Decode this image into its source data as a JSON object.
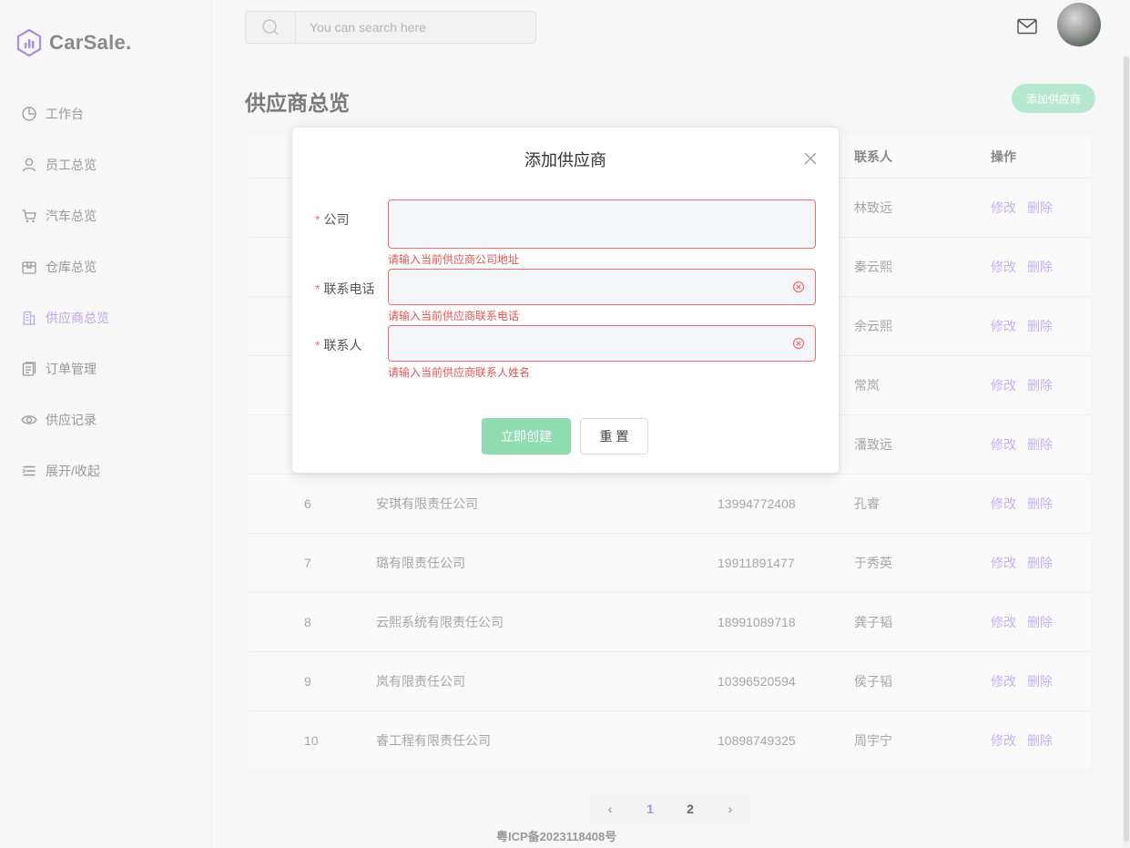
{
  "brand": {
    "name": "CarSale."
  },
  "sidebar": {
    "items": [
      {
        "label": "工作台",
        "icon": "pie-chart-icon",
        "active": false
      },
      {
        "label": "员工总览",
        "icon": "user-icon",
        "active": false
      },
      {
        "label": "汽车总览",
        "icon": "cart-icon",
        "active": false
      },
      {
        "label": "仓库总览",
        "icon": "box-icon",
        "active": false
      },
      {
        "label": "供应商总览",
        "icon": "building-icon",
        "active": true
      },
      {
        "label": "订单管理",
        "icon": "document-icon",
        "active": false
      },
      {
        "label": "供应记录",
        "icon": "eye-icon",
        "active": false
      },
      {
        "label": "展开/收起",
        "icon": "menu-icon",
        "active": false
      }
    ]
  },
  "header": {
    "search_placeholder": "You can search here"
  },
  "main": {
    "title": "供应商总览",
    "add_button": "添加供应商",
    "table": {
      "columns": [
        "联系人",
        "操作"
      ],
      "edit_label": "修改",
      "delete_label": "删除",
      "rows": [
        {
          "no": "",
          "company": "",
          "phone": "",
          "contact": "林致远"
        },
        {
          "no": "",
          "company": "",
          "phone": "",
          "contact": "秦云熙"
        },
        {
          "no": "",
          "company": "",
          "phone": "",
          "contact": "余云熙"
        },
        {
          "no": "",
          "company": "",
          "phone": "",
          "contact": "常岚"
        },
        {
          "no": "",
          "company": "",
          "phone": "",
          "contact": "潘致远"
        },
        {
          "no": "6",
          "company": "安琪有限责任公司",
          "phone": "13994772408",
          "contact": "孔睿"
        },
        {
          "no": "7",
          "company": "璐有限责任公司",
          "phone": "19911891477",
          "contact": "于秀英"
        },
        {
          "no": "8",
          "company": "云熙系统有限责任公司",
          "phone": "18991089718",
          "contact": "龚子韬"
        },
        {
          "no": "9",
          "company": "岚有限责任公司",
          "phone": "10396520594",
          "contact": "侯子韬"
        },
        {
          "no": "10",
          "company": "睿工程有限责任公司",
          "phone": "10898749325",
          "contact": "周宇宁"
        }
      ]
    },
    "pagination": {
      "prev": "‹",
      "pages": [
        "1",
        "2"
      ],
      "next": "›",
      "current": "1"
    },
    "footer": "粤ICP备2023118408号"
  },
  "modal": {
    "title": "添加供应商",
    "fields": [
      {
        "label": "公司",
        "value": "",
        "error": "请输入当前供应商公司地址"
      },
      {
        "label": "联系电话",
        "value": "",
        "error": "请输入当前供应商联系电话"
      },
      {
        "label": "联系人",
        "value": "",
        "error": "请输入当前供应商联系人姓名"
      }
    ],
    "create_button": "立即创建",
    "reset_button": "重 置"
  },
  "colors": {
    "accent": "#c0a7e6",
    "primary_green": "#8fdcb3",
    "error": "#f56c6c"
  }
}
